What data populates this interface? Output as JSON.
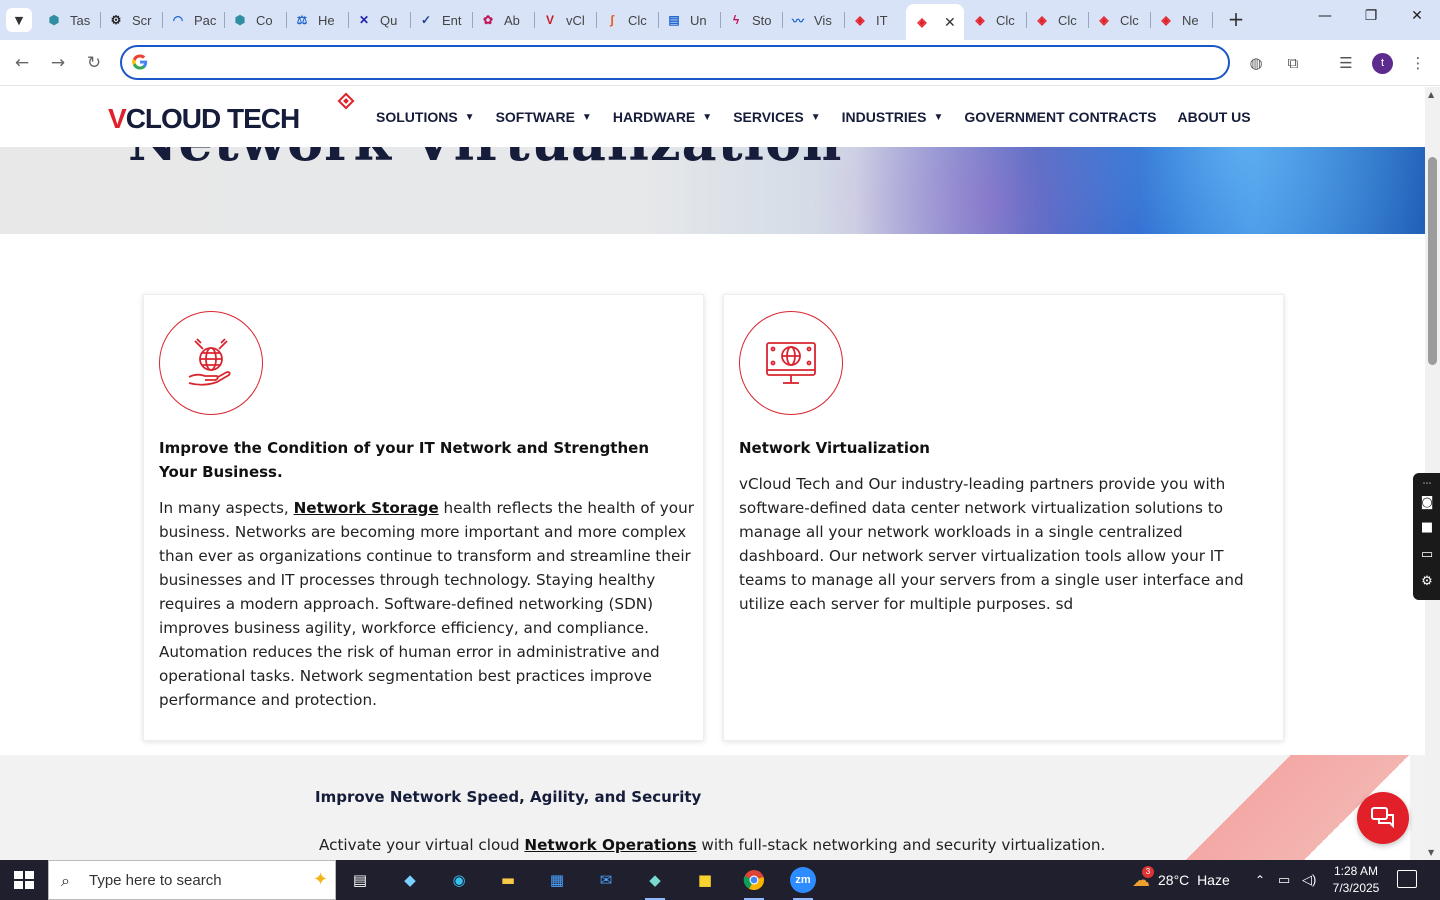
{
  "browser": {
    "tabs": [
      {
        "label": "Tas",
        "icon": "hexagon-teal-icon"
      },
      {
        "label": "Scr",
        "icon": "gear-black-icon"
      },
      {
        "label": "Pac",
        "icon": "speedometer-icon"
      },
      {
        "label": "Co",
        "icon": "hexagon-teal-icon"
      },
      {
        "label": "He",
        "icon": "scales-icon"
      },
      {
        "label": "Qu",
        "icon": "x-logo-icon"
      },
      {
        "label": "Ent",
        "icon": "check-icon"
      },
      {
        "label": "Ab",
        "icon": "figma-icon"
      },
      {
        "label": "vCl",
        "icon": "v-logo-icon"
      },
      {
        "label": "Clc",
        "icon": "swoosh-icon"
      },
      {
        "label": "Un",
        "icon": "doc-icon"
      },
      {
        "label": "Sto",
        "icon": "bolt-icon"
      },
      {
        "label": "Vis",
        "icon": "pulse-icon"
      },
      {
        "label": "IT",
        "icon": "vcloud-icon"
      },
      {
        "label": "",
        "icon": "vcloud-icon",
        "active": true
      },
      {
        "label": "Clc",
        "icon": "vcloud-icon"
      },
      {
        "label": "Clc",
        "icon": "vcloud-icon"
      },
      {
        "label": "Clc",
        "icon": "vcloud-icon"
      },
      {
        "label": "Ne",
        "icon": "vcloud-icon"
      }
    ],
    "address_value": "",
    "profile_initial": "t"
  },
  "site": {
    "logo_v": "V",
    "logo_rest": "CLOUD TECH",
    "menu": [
      {
        "label": "SOLUTIONS",
        "has_caret": true
      },
      {
        "label": "SOFTWARE",
        "has_caret": true
      },
      {
        "label": "HARDWARE",
        "has_caret": true
      },
      {
        "label": "SERVICES",
        "has_caret": true
      },
      {
        "label": "INDUSTRIES",
        "has_caret": true
      },
      {
        "label": "GOVERNMENT CONTRACTS",
        "has_caret": false
      },
      {
        "label": "ABOUT US",
        "has_caret": false
      }
    ],
    "hero_title": "Network Virtualization",
    "cards": [
      {
        "icon": "globe-hand-icon",
        "title": "Improve the Condition of your IT Network and Strengthen Your Business.",
        "body_pre": "In many aspects, ",
        "body_link": "Network Storage",
        "body_post": " health reflects the health of your business. Networks are becoming more important and more complex than ever as organizations continue to transform and streamline their businesses and IT processes through technology. Staying healthy requires a modern approach. Software-defined networking (SDN) improves business agility, workforce efficiency, and compliance. Automation reduces the risk of human error in administrative and operational tasks. Network segmentation best practices improve performance and protection."
      },
      {
        "icon": "monitor-globe-icon",
        "title": "Network Virtualization",
        "body": "vCloud Tech and Our industry-leading partners provide you with software-defined data center network virtualization solutions to manage all your network workloads in a single centralized dashboard. Our network server virtualization tools allow your IT teams to manage all your servers from a single user interface and utilize each server for multiple purposes.  sd"
      }
    ],
    "band": {
      "heading": "Improve Network Speed, Agility, and Security",
      "text_pre": "Activate your virtual cloud ",
      "text_link": "Network Operations",
      "text_post": " with full-stack networking and security virtualization."
    }
  },
  "taskbar": {
    "search_placeholder": "Type here to search",
    "weather_temp": "28°C",
    "weather_desc": "Haze",
    "weather_badge": "3",
    "time": "1:28 AM",
    "date": "7/3/2025"
  },
  "colors": {
    "brand_red": "#e2202a",
    "brand_navy": "#161d3a",
    "chrome_tabstrip": "#d8e3f7",
    "omnibox_border": "#1a56c8"
  }
}
